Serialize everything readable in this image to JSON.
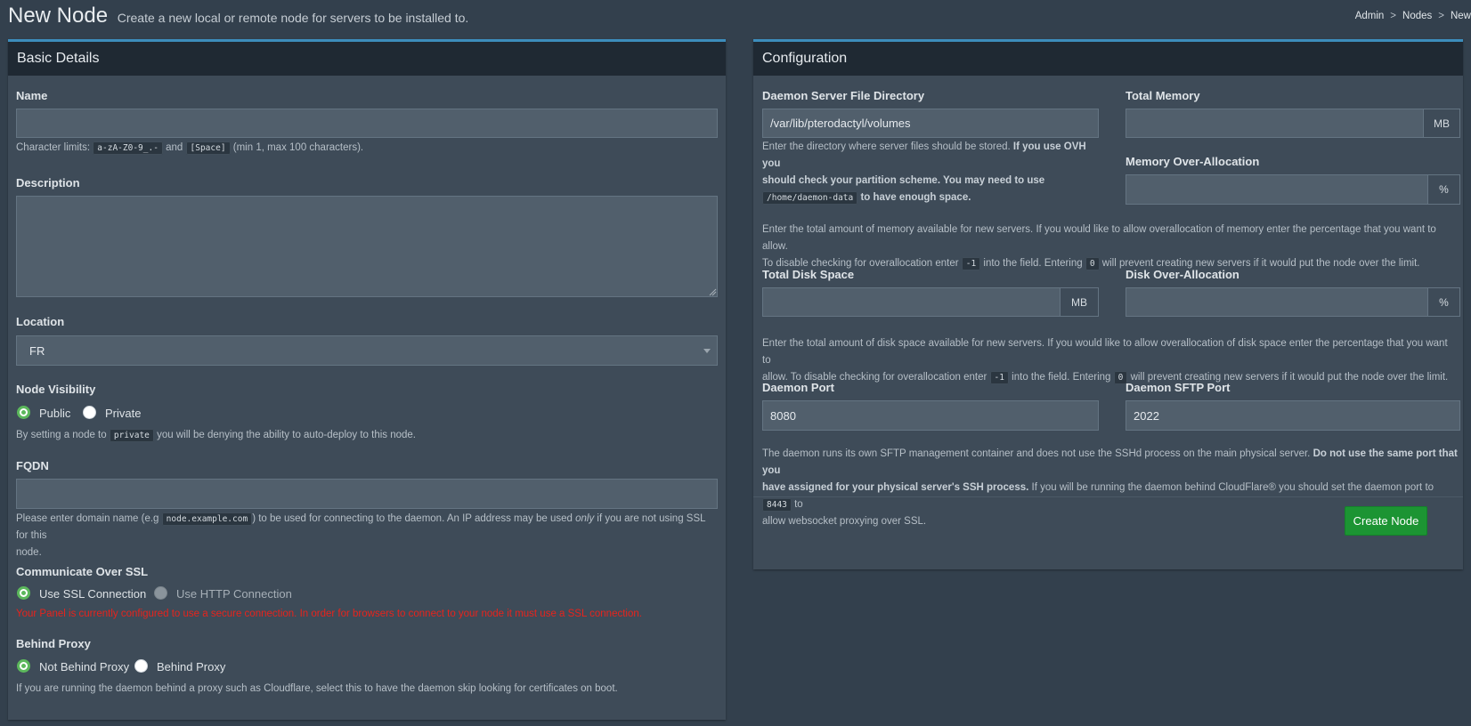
{
  "header": {
    "title": "New Node",
    "subtitle": "Create a new local or remote node for servers to be installed to.",
    "breadcrumb": [
      "Admin",
      "Nodes",
      "New"
    ],
    "separator": ">"
  },
  "basic": {
    "heading": "Basic Details",
    "name": {
      "label": "Name",
      "value": "",
      "help_pre": "Character limits:",
      "code1": "a-zA-Z0-9_.-",
      "help_and": "and",
      "code2": "[Space]",
      "help_post": "(min 1, max 100 characters)."
    },
    "description": {
      "label": "Description",
      "value": ""
    },
    "location": {
      "label": "Location",
      "selected": "FR"
    },
    "visibility": {
      "label": "Node Visibility",
      "options": [
        "Public",
        "Private"
      ],
      "help_pre": "By setting a node to",
      "code": "private",
      "help_post": "you will be denying the ability to auto-deploy to this node."
    },
    "fqdn": {
      "label": "FQDN",
      "value": "",
      "help_pre": "Please enter domain name (e.g",
      "code": "node.example.com",
      "help_mid": ") to be used for connecting to the daemon. An IP address may be used",
      "help_em": "only",
      "help_post": "if you are not using SSL for this",
      "help_line2": "node."
    },
    "ssl": {
      "label": "Communicate Over SSL",
      "options": [
        "Use SSL Connection",
        "Use HTTP Connection"
      ],
      "error": "Your Panel is currently configured to use a secure connection. In order for browsers to connect to your node it must use a SSL connection."
    },
    "proxy": {
      "label": "Behind Proxy",
      "options": [
        "Not Behind Proxy",
        "Behind Proxy"
      ],
      "help": "If you are running the daemon behind a proxy such as Cloudflare, select this to have the daemon skip looking for certificates on boot."
    }
  },
  "config": {
    "heading": "Configuration",
    "directory": {
      "label": "Daemon Server File Directory",
      "value": "/var/lib/pterodactyl/volumes",
      "help1": "Enter the directory where server files should be stored.",
      "help1_bold": "If you use OVH you",
      "help2_bold": "should check your partition scheme. You may need to use",
      "code": "/home/daemon-data",
      "help3_bold": "to have enough space."
    },
    "memory": {
      "label": "Total Memory",
      "value": "",
      "unit": "MB"
    },
    "memory_over": {
      "label": "Memory Over-Allocation",
      "value": "",
      "unit": "%"
    },
    "memory_help": {
      "line1": "Enter the total amount of memory available for new servers. If you would like to allow overallocation of memory enter the percentage that you want to allow.",
      "line2_pre": "To disable checking for overallocation enter",
      "code1": "-1",
      "line2_mid": "into the field. Entering",
      "code2": "0",
      "line2_post": "will prevent creating new servers if it would put the node over the limit."
    },
    "disk": {
      "label": "Total Disk Space",
      "value": "",
      "unit": "MB"
    },
    "disk_over": {
      "label": "Disk Over-Allocation",
      "value": "",
      "unit": "%"
    },
    "disk_help": {
      "line1": "Enter the total amount of disk space available for new servers. If you would like to allow overallocation of disk space enter the percentage that you want to",
      "line2_pre": "allow. To disable checking for overallocation enter",
      "code1": "-1",
      "line2_mid": "into the field. Entering",
      "code2": "0",
      "line2_post": "will prevent creating new servers if it would put the node over the limit."
    },
    "port": {
      "label": "Daemon Port",
      "value": "8080"
    },
    "sftp": {
      "label": "Daemon SFTP Port",
      "value": "2022"
    },
    "daemon_help": {
      "line1_pre": "The daemon runs its own SFTP management container and does not use the SSHd process on the main physical server.",
      "line1_bold": "Do not use the same port that you",
      "line2_bold": "have assigned for your physical server's SSH process.",
      "line2_post": "If you will be running the daemon behind CloudFlare® you should set the daemon port to",
      "code": "8443",
      "line2_end": "to",
      "line3": "allow websocket proxying over SSL."
    },
    "submit": "Create Node"
  },
  "colors": {
    "accent": "#3c8dbc",
    "success": "#1c9433",
    "error": "#e8231c",
    "panel": "#3e4b58",
    "background": "#33404d"
  }
}
